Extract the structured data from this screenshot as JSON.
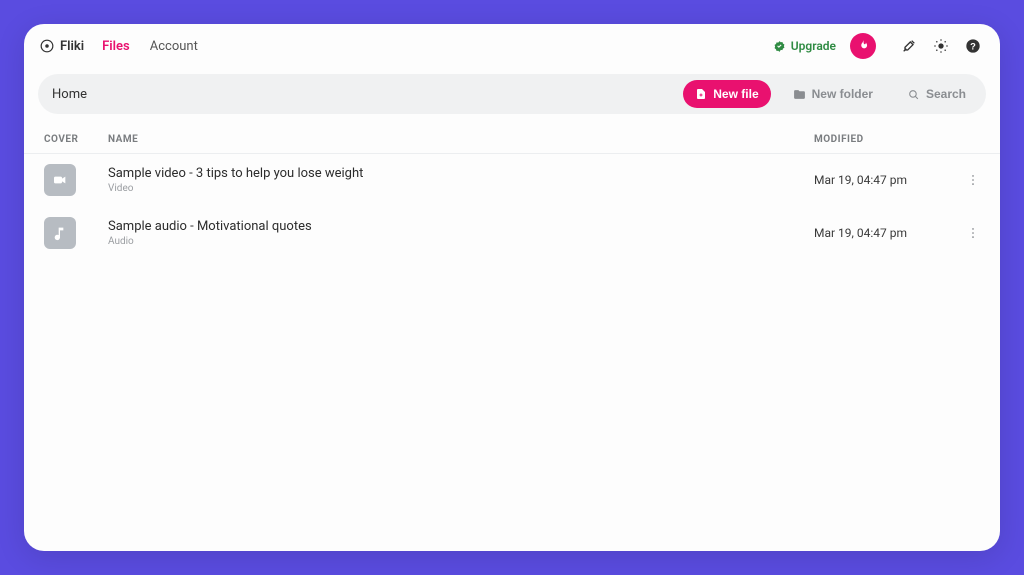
{
  "brand": {
    "name": "Fliki"
  },
  "nav": {
    "files": "Files",
    "account": "Account",
    "active": "files"
  },
  "top": {
    "upgrade": "Upgrade"
  },
  "toolbar": {
    "breadcrumb": "Home",
    "new_file": "New file",
    "new_folder": "New folder",
    "search": "Search"
  },
  "table": {
    "head": {
      "cover": "Cover",
      "name": "Name",
      "modified": "Modified"
    },
    "rows": [
      {
        "kind": "video",
        "name": "Sample video - 3 tips to help you lose weight",
        "type": "Video",
        "modified": "Mar 19, 04:47 pm"
      },
      {
        "kind": "audio",
        "name": "Sample audio - Motivational quotes",
        "type": "Audio",
        "modified": "Mar 19, 04:47 pm"
      }
    ]
  }
}
